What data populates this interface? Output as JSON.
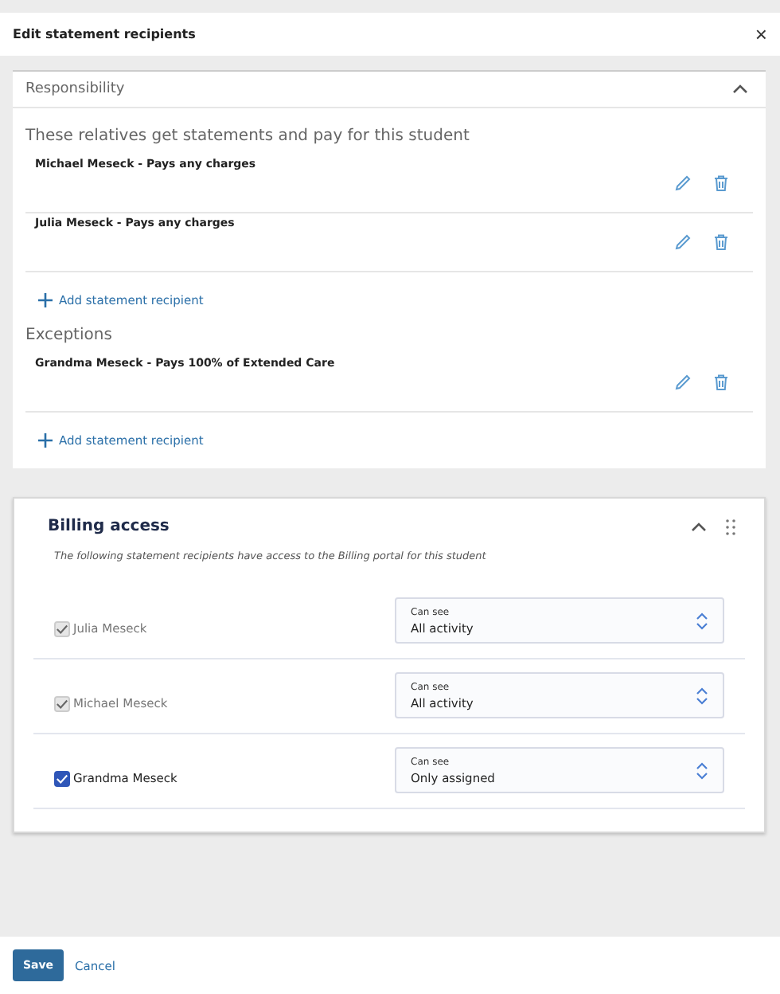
{
  "dialog": {
    "title": "Edit statement recipients",
    "close": "×"
  },
  "responsibility": {
    "title": "Responsibility",
    "expanded": true,
    "sections": [
      {
        "heading": "These relatives get statements and pay for this student",
        "recipients": [
          "Michael Meseck - Pays any charges",
          "Julia Meseck - Pays any charges"
        ],
        "add_link": "Add statement recipient"
      },
      {
        "heading": "Exceptions",
        "recipients": [
          "Grandma Meseck - Pays 100% of Extended Care"
        ],
        "add_link": "Add statement recipient"
      }
    ]
  },
  "billing_access": {
    "title": "Billing access",
    "expanded": true,
    "description": "The following statement recipients have access to the Billing portal for this student",
    "rows": [
      {
        "name": "Julia Meseck",
        "checked": true,
        "disabled": true,
        "select_label": "Can see",
        "select_value": "All activity"
      },
      {
        "name": "Michael Meseck",
        "checked": true,
        "disabled": true,
        "select_label": "Can see",
        "select_value": "All activity"
      },
      {
        "name": "Grandma Meseck",
        "checked": true,
        "disabled": false,
        "select_label": "Can see",
        "select_value": "Only assigned"
      }
    ]
  },
  "footer": {
    "save": "Save",
    "cancel": "Cancel"
  }
}
